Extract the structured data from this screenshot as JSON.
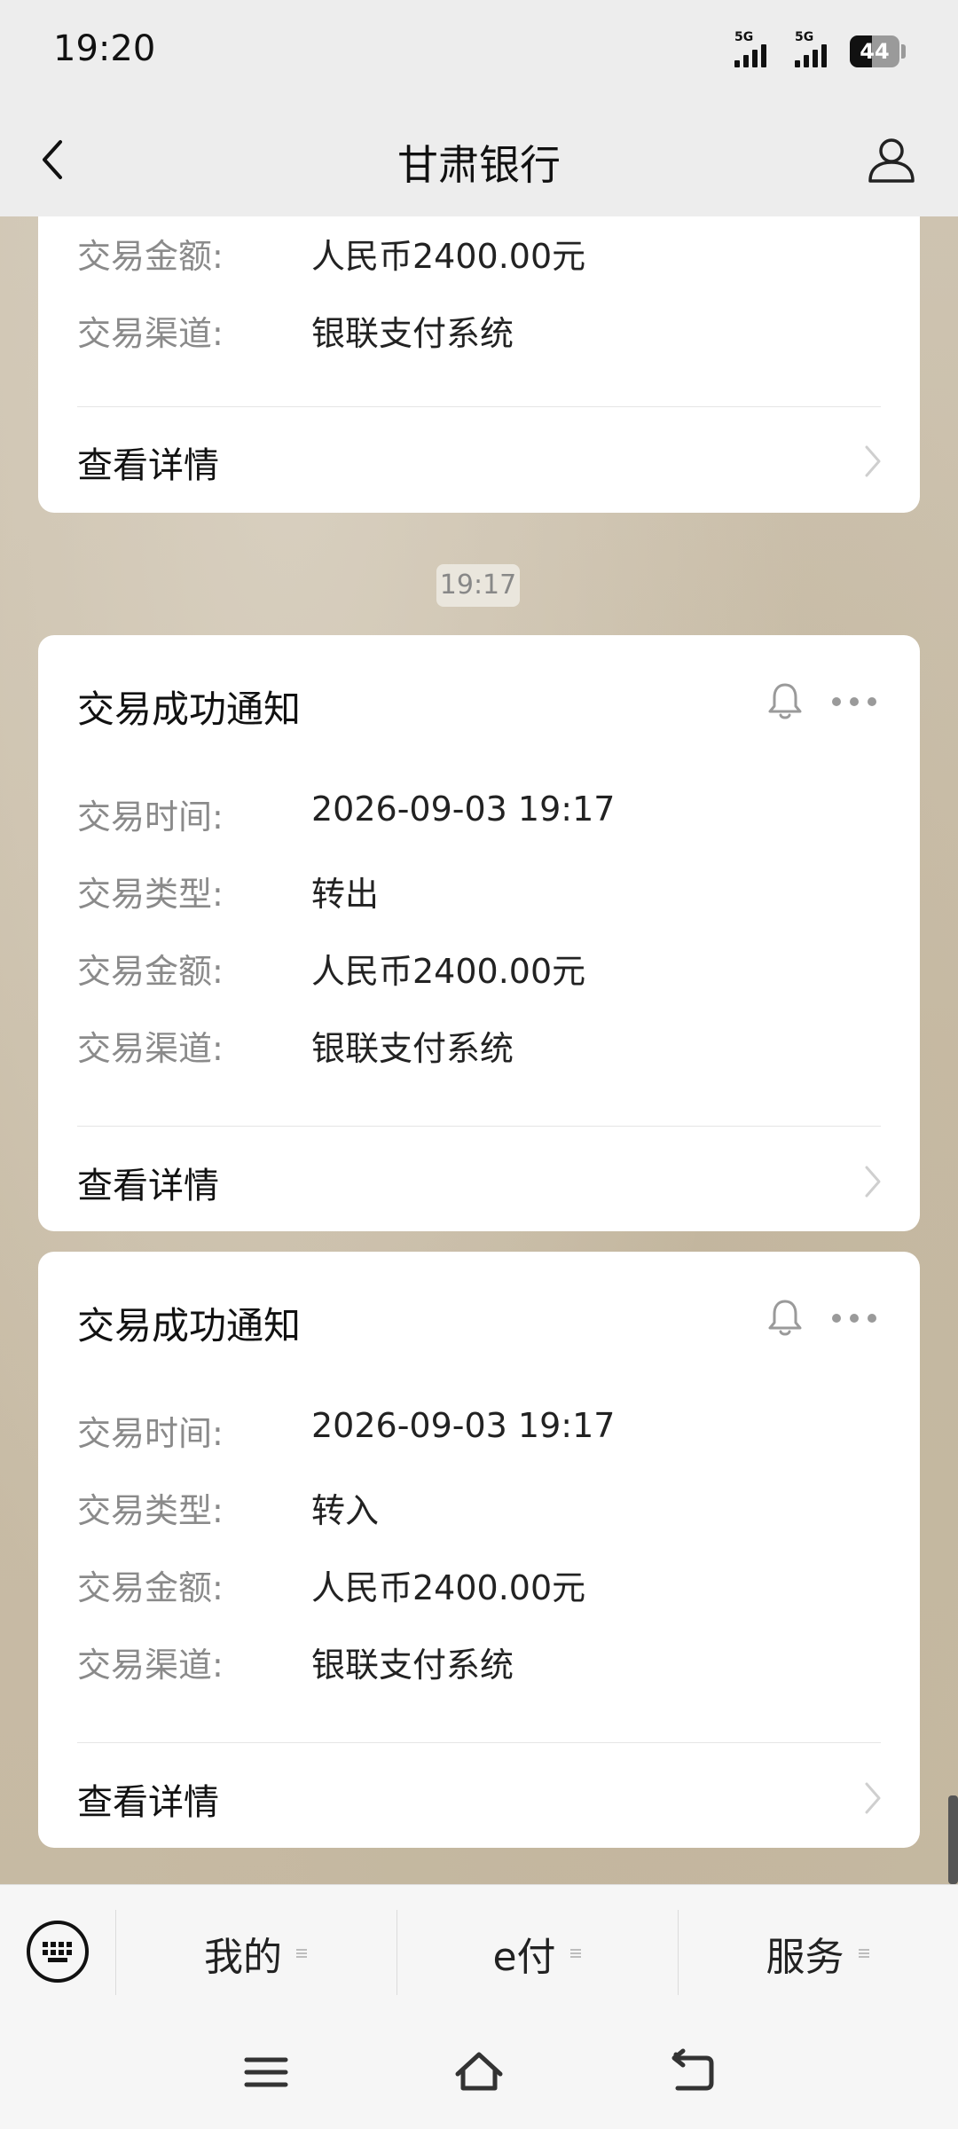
{
  "status_bar": {
    "time": "19:20",
    "signal_1_label": "5G",
    "signal_2_label": "5G",
    "battery_level": 44,
    "battery_text": "44"
  },
  "nav": {
    "title": "甘肃银行",
    "back_icon": "chevron-left-icon",
    "profile_icon": "user-icon"
  },
  "partial_card": {
    "rows": [
      {
        "label": "交易金额:",
        "value": "人民币2400.00元"
      },
      {
        "label": "交易渠道:",
        "value": "银联支付系统"
      }
    ],
    "detail_label": "查看详情"
  },
  "time_chip": "19:17",
  "cards": [
    {
      "title": "交易成功通知",
      "rows": [
        {
          "label": "交易时间:",
          "value": "2026-09-03 19:17"
        },
        {
          "label": "交易类型:",
          "value": "转出"
        },
        {
          "label": "交易金额:",
          "value": "人民币2400.00元"
        },
        {
          "label": "交易渠道:",
          "value": "银联支付系统"
        }
      ],
      "detail_label": "查看详情"
    },
    {
      "title": "交易成功通知",
      "rows": [
        {
          "label": "交易时间:",
          "value": "2026-09-03 19:17"
        },
        {
          "label": "交易类型:",
          "value": "转入"
        },
        {
          "label": "交易金额:",
          "value": "人民币2400.00元"
        },
        {
          "label": "交易渠道:",
          "value": "银联支付系统"
        }
      ],
      "detail_label": "查看详情"
    }
  ],
  "bottom_menu": {
    "items": [
      "我的",
      "e付",
      "服务"
    ]
  },
  "colors": {
    "background": "#cbbfa9",
    "card": "#ffffff",
    "label": "#8a8a8a",
    "value": "#222222",
    "bar": "#ededed"
  }
}
